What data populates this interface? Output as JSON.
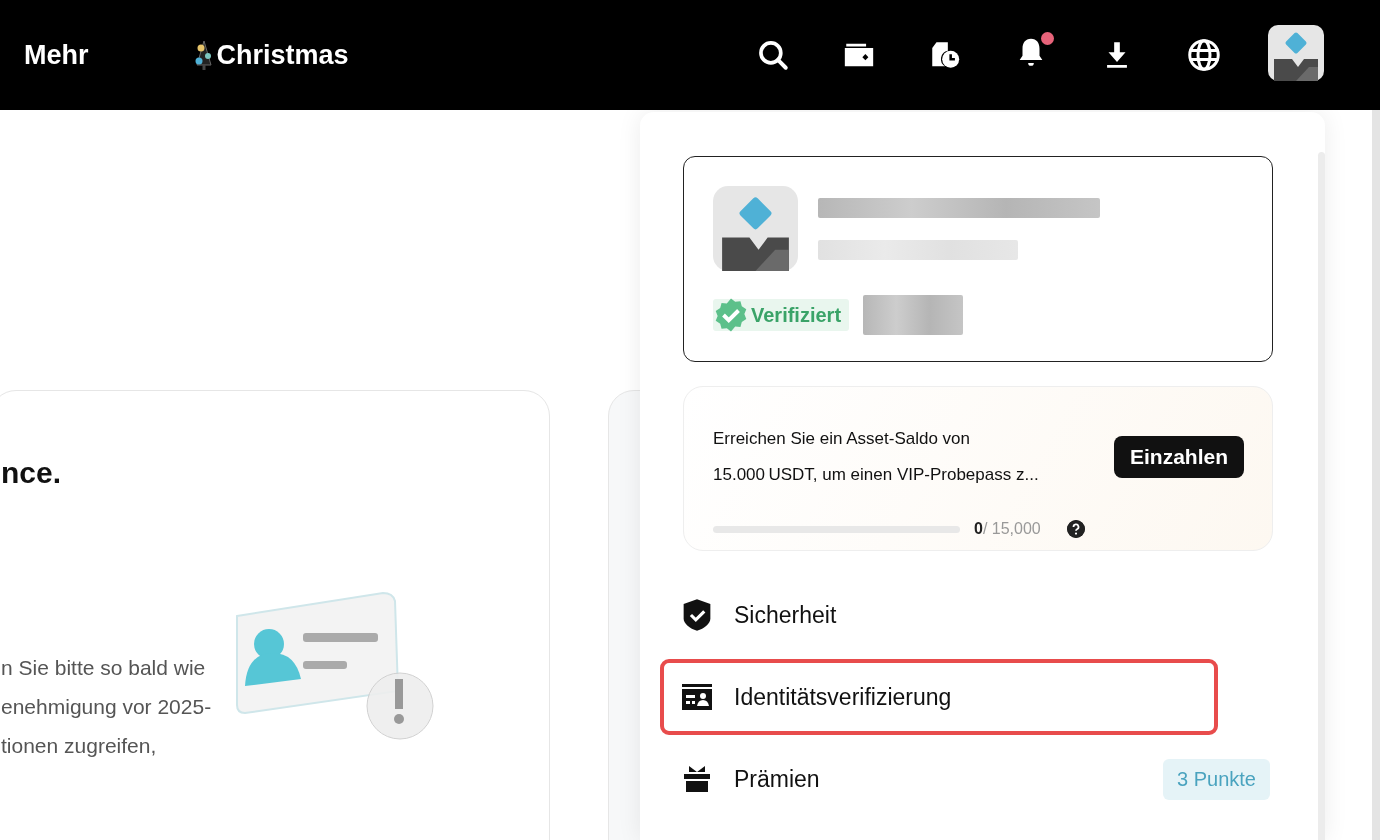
{
  "topbar": {
    "nav": [
      {
        "label": "Mehr",
        "kind": "text"
      },
      {
        "label": "Christmas",
        "kind": "tree"
      }
    ],
    "notification_dot": true
  },
  "page": {
    "card_title": "nce.",
    "card_text_lines": [
      "n Sie bitte so bald wie",
      "enehmigung vor 2025-",
      "tionen zugreifen,"
    ]
  },
  "dropdown": {
    "profile": {
      "verified": true,
      "badge": "Verifiziert"
    },
    "promo": {
      "text_lines": [
        "Erreichen Sie ein Asset-Saldo von",
        "15.000 USDT, um einen VIP-Probepass z..."
      ],
      "button": "Einzahlen",
      "level": 0,
      "current": "0",
      "target": "/ 15,000"
    },
    "menu": [
      {
        "label": "Sicherheit",
        "kind": "shield",
        "highlighted": false
      },
      {
        "label": "Identitätsverifizierung",
        "kind": "idcard",
        "highlighted": true
      },
      {
        "label": "Prämien",
        "kind": "gift",
        "highlighted": false,
        "badge": "3 Punkte"
      }
    ]
  }
}
